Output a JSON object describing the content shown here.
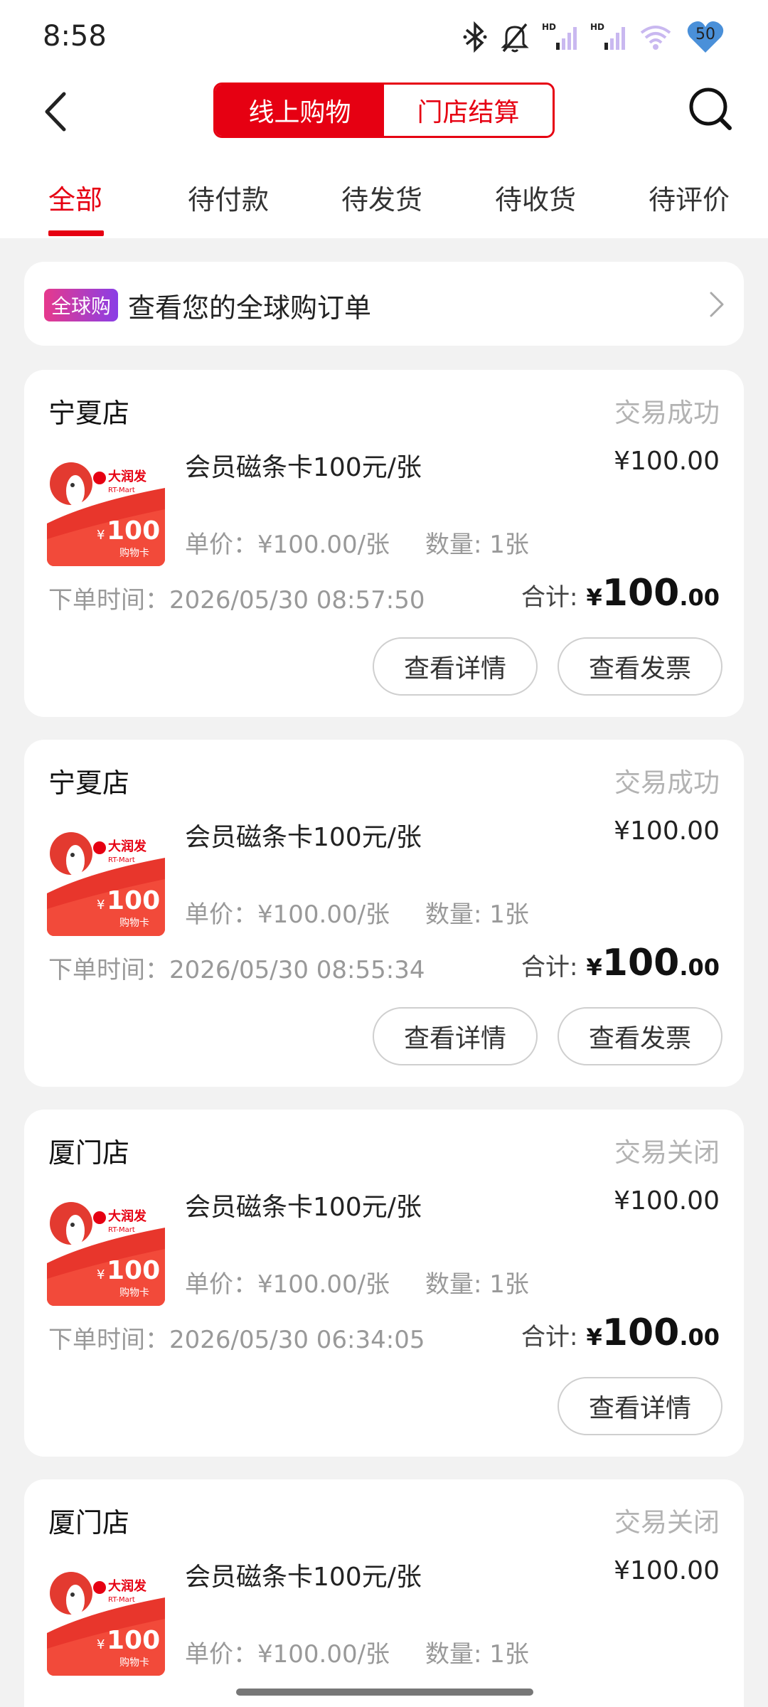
{
  "status_bar": {
    "time": "8:58",
    "battery": "50",
    "icons": [
      "bluetooth-icon",
      "mute-bell-icon",
      "hd-signal-icon",
      "hd-signal-icon",
      "wifi-icon",
      "battery-heart-icon"
    ]
  },
  "header": {
    "segments": [
      "线上购物",
      "门店结算"
    ],
    "active_segment": 0
  },
  "tabs": [
    "全部",
    "待付款",
    "待发货",
    "待收货",
    "待评价"
  ],
  "global_banner": {
    "badge": "全球购",
    "text": "查看您的全球购订单"
  },
  "product_thumb": {
    "brand": "大润发",
    "brand_en": "RT-Mart",
    "yen": "¥",
    "amount": "100",
    "caption": "购物卡"
  },
  "labels": {
    "unit_price_prefix": "单价：",
    "quantity_prefix": "数量: ",
    "order_time_prefix": "下单时间：",
    "total_label": "合计:",
    "yen": "¥",
    "view_detail": "查看详情",
    "view_invoice": "查看发票"
  },
  "orders": [
    {
      "store": "宁夏店",
      "status": "交易成功",
      "product_name": "会员磁条卡100元/张",
      "price": "¥100.00",
      "unit_price": "¥100.00/张",
      "quantity": "1张",
      "order_time": "2026/05/30 08:57:50",
      "total_int": "100",
      "total_dec": ".00",
      "has_invoice": true
    },
    {
      "store": "宁夏店",
      "status": "交易成功",
      "product_name": "会员磁条卡100元/张",
      "price": "¥100.00",
      "unit_price": "¥100.00/张",
      "quantity": "1张",
      "order_time": "2026/05/30 08:55:34",
      "total_int": "100",
      "total_dec": ".00",
      "has_invoice": true
    },
    {
      "store": "厦门店",
      "status": "交易关闭",
      "product_name": "会员磁条卡100元/张",
      "price": "¥100.00",
      "unit_price": "¥100.00/张",
      "quantity": "1张",
      "order_time": "2026/05/30 06:34:05",
      "total_int": "100",
      "total_dec": ".00",
      "has_invoice": false
    },
    {
      "store": "厦门店",
      "status": "交易关闭",
      "product_name": "会员磁条卡100元/张",
      "price": "¥100.00",
      "unit_price": "¥100.00/张",
      "quantity": "1张",
      "order_time": "",
      "total_int": "",
      "total_dec": "",
      "has_invoice": false
    }
  ],
  "colors": {
    "accent": "#e60012",
    "muted": "#999999",
    "status": "#b3b3b3",
    "background": "#f2f2f2"
  }
}
